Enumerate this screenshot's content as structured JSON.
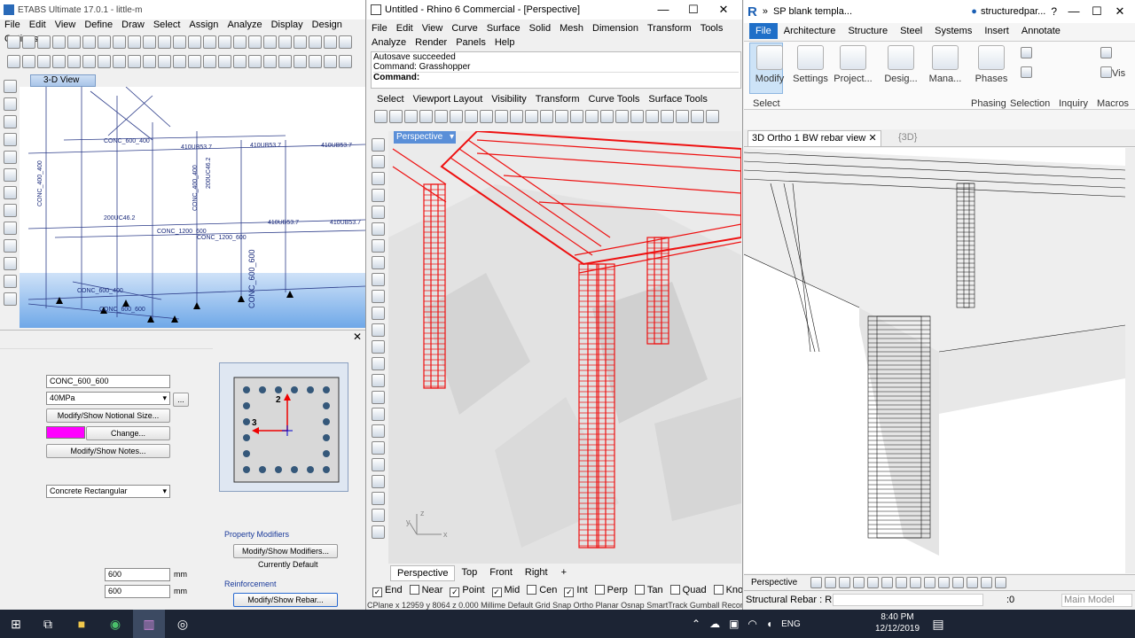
{
  "etabs": {
    "title": "ETABS Ultimate 17.0.1 - little-m",
    "menu": [
      "File",
      "Edit",
      "View",
      "Define",
      "Draw",
      "Select",
      "Assign",
      "Analyze",
      "Display",
      "Design",
      "Options"
    ],
    "view_tab": "3-D View",
    "model_labels": [
      "CONC_600_400",
      "410UB53.7",
      "200UC46.2",
      "CONC_400_400",
      "CONC_1200_600",
      "CONC_600_600",
      "CONC_400_400",
      "410UB53.7",
      "410UB53.7",
      "200UC46.2",
      "CONC_1200_600",
      "CONC_600_600",
      "CONC_600_400"
    ],
    "dialog": {
      "section_name": "CONC_600_600",
      "material": "40MPa",
      "notional_btn": "Modify/Show Notional Size...",
      "change_btn": "Change...",
      "notes_btn": "Modify/Show Notes...",
      "shape": "Concrete Rectangular",
      "depth": "600",
      "width": "600",
      "unit1": "mm",
      "unit2": "mm",
      "pm_header": "Property Modifiers",
      "pm_btn": "Modify/Show Modifiers...",
      "pm_status": "Currently Default",
      "reinf_header": "Reinforcement",
      "rebar_btn": "Modify/Show Rebar...",
      "axis2": "2",
      "axis3": "3"
    },
    "color": "#ff00ff"
  },
  "rhino": {
    "title": "Untitled - Rhino 6 Commercial - [Perspective]",
    "menu": [
      "File",
      "Edit",
      "View",
      "Curve",
      "Surface",
      "Solid",
      "Mesh",
      "Dimension",
      "Transform",
      "Tools",
      "Analyze",
      "Render",
      "Panels",
      "Help"
    ],
    "cmd_history": [
      "Autosave succeeded",
      "Command: Grasshopper"
    ],
    "cmd_label": "Command:",
    "toolbar_tabs": [
      "Select",
      "Viewport Layout",
      "Visibility",
      "Transform",
      "Curve Tools",
      "Surface Tools"
    ],
    "viewport_label": "Perspective",
    "view_tabs": [
      "Perspective",
      "Top",
      "Front",
      "Right"
    ],
    "add_tab": "+",
    "osnaps": [
      {
        "label": "End",
        "on": true
      },
      {
        "label": "Near",
        "on": false
      },
      {
        "label": "Point",
        "on": true
      },
      {
        "label": "Mid",
        "on": true
      },
      {
        "label": "Cen",
        "on": false
      },
      {
        "label": "Int",
        "on": true
      },
      {
        "label": "Perp",
        "on": false
      },
      {
        "label": "Tan",
        "on": false
      },
      {
        "label": "Quad",
        "on": false
      },
      {
        "label": "Knot",
        "on": false
      }
    ],
    "status": "CPlane x 12959 y 8064 z 0.000  Millime",
    "status_right": "Default      Grid Snap Ortho Planar Osnap SmartTrack Gumball Record History",
    "axis_z": "z",
    "axis_y": "y",
    "axis_x": "x"
  },
  "revit": {
    "title": "SP blank templa...",
    "user": "structuredpar...",
    "tabs": [
      "File",
      "Architecture",
      "Structure",
      "Steel",
      "Systems",
      "Insert",
      "Annotate"
    ],
    "ribbon": [
      "Modify",
      "Settings",
      "Project...",
      "Desig...",
      "Mana...",
      "Phases"
    ],
    "panels": [
      "Select",
      "Phasing",
      "Selection",
      "Inquiry",
      "Macros"
    ],
    "vis": "Vis",
    "doc_tab_active": "3D Ortho 1 BW rebar view",
    "doc_tab_2": "{3D}",
    "view_label": "Perspective",
    "status": "Structural Rebar : R",
    "status_zero": ":0",
    "model": "Main Model"
  },
  "taskbar": {
    "time": "8:40 PM",
    "date": "12/12/2019",
    "lang": "ENG"
  }
}
